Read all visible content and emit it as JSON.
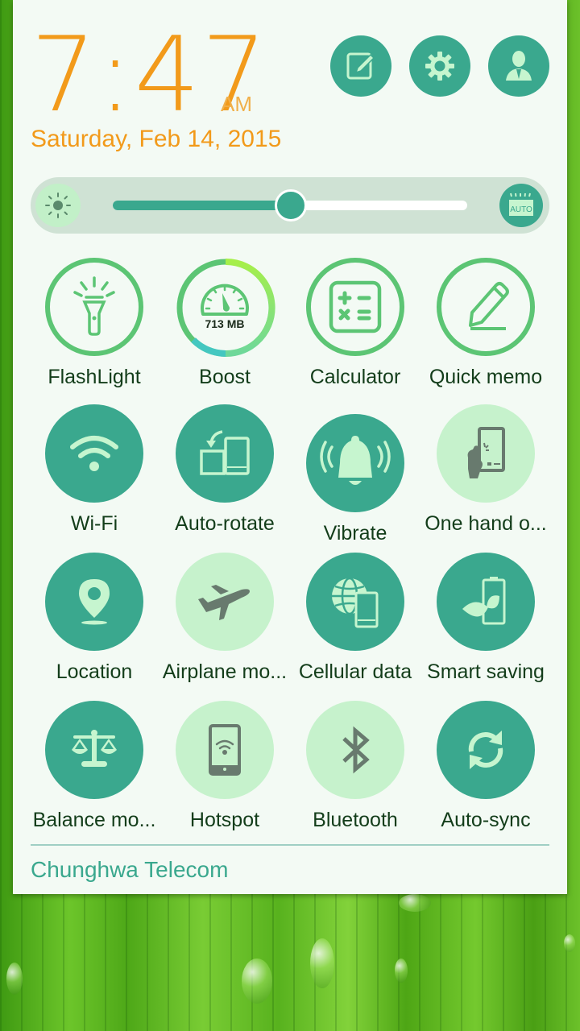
{
  "clock": {
    "time": "7:47",
    "ampm": "AM",
    "date": "Saturday, Feb 14, 2015"
  },
  "top_buttons": [
    {
      "name": "quick-note",
      "icon": "edit-note-icon"
    },
    {
      "name": "settings",
      "icon": "gear-icon"
    },
    {
      "name": "user-profile",
      "icon": "user-icon"
    }
  ],
  "brightness": {
    "level_percent": 50,
    "auto_label": "AUTO"
  },
  "tiles": [
    {
      "label": "FlashLight",
      "icon": "flashlight-icon",
      "state": "outline"
    },
    {
      "label": "Boost",
      "icon": "speedometer-icon",
      "state": "outline",
      "memory": "713 MB"
    },
    {
      "label": "Calculator",
      "icon": "calculator-icon",
      "state": "outline"
    },
    {
      "label": "Quick memo",
      "icon": "pencil-icon",
      "state": "outline"
    },
    {
      "label": "Wi-Fi",
      "icon": "wifi-icon",
      "state": "on"
    },
    {
      "label": "Auto-rotate",
      "icon": "rotate-icon",
      "state": "on"
    },
    {
      "label": "Vibrate",
      "icon": "bell-icon",
      "state": "on"
    },
    {
      "label": "One hand o...",
      "icon": "one-hand-icon",
      "state": "off"
    },
    {
      "label": "Location",
      "icon": "location-pin-icon",
      "state": "on"
    },
    {
      "label": "Airplane mo...",
      "icon": "airplane-icon",
      "state": "off"
    },
    {
      "label": "Cellular data",
      "icon": "globe-phone-icon",
      "state": "on"
    },
    {
      "label": "Smart saving",
      "icon": "battery-leaf-icon",
      "state": "on"
    },
    {
      "label": "Balance mo...",
      "icon": "scale-icon",
      "state": "on"
    },
    {
      "label": "Hotspot",
      "icon": "hotspot-icon",
      "state": "off"
    },
    {
      "label": "Bluetooth",
      "icon": "bluetooth-icon",
      "state": "off"
    },
    {
      "label": "Auto-sync",
      "icon": "sync-icon",
      "state": "on"
    }
  ],
  "carrier": "Chunghwa Telecom",
  "colors": {
    "accent": "#3aa88e",
    "clock": "#f29a1a",
    "tile_off": "#c6f2cc",
    "outline": "#5cc574"
  }
}
